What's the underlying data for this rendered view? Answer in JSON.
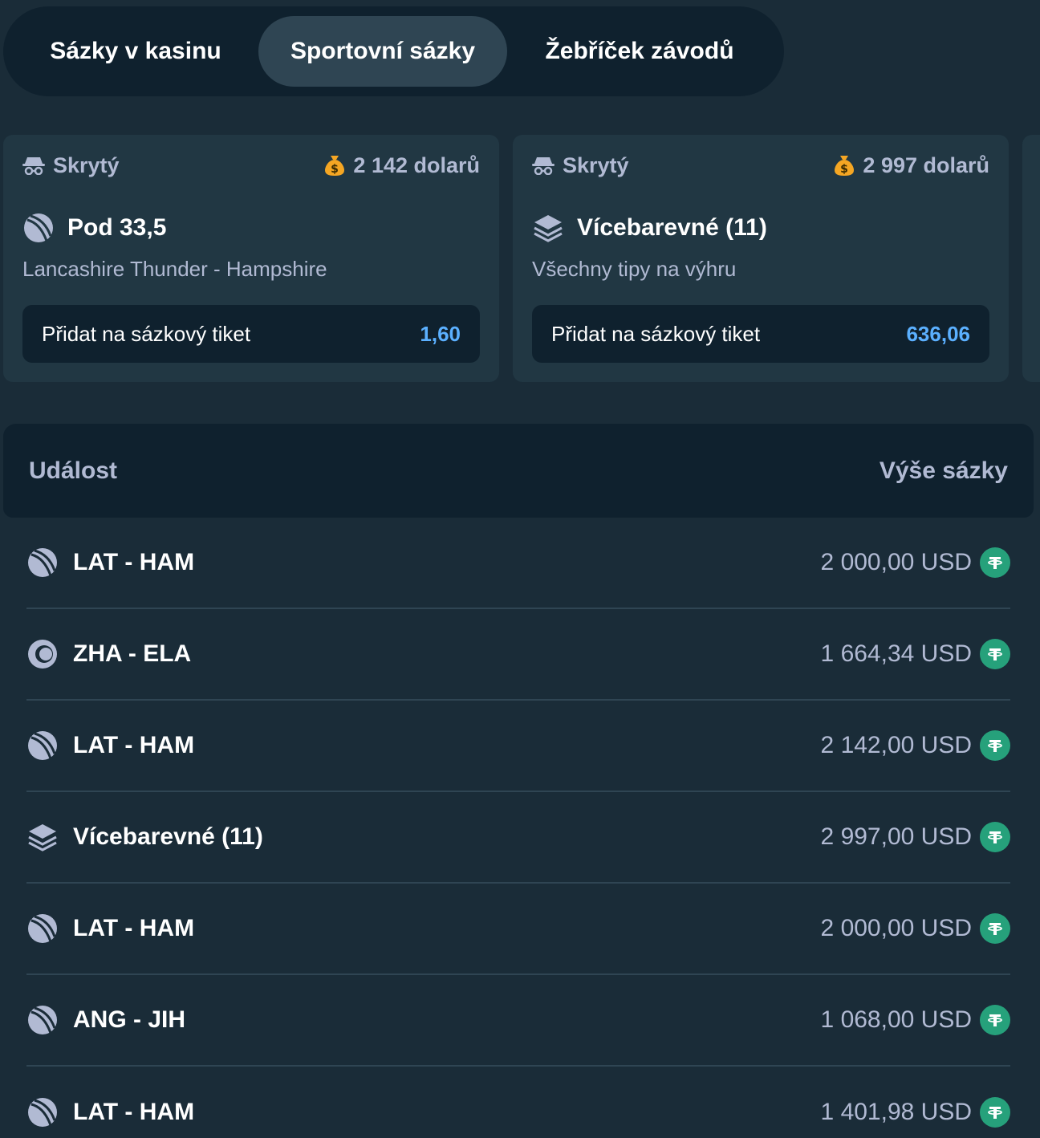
{
  "tabs": [
    {
      "label": "Sázky v kasinu"
    },
    {
      "label": "Sportovní sázky"
    },
    {
      "label": "Žebříček závodů"
    }
  ],
  "cards": [
    {
      "user": "Skrytý",
      "amount": "2 142 dolarů",
      "title": "Pod 33,5",
      "sport_icon": "cricket-ball-icon",
      "subtitle": "Lancashire Thunder - Hampshire",
      "button_label": "Přidat na sázkový tiket",
      "odds": "1,60"
    },
    {
      "user": "Skrytý",
      "amount": "2 997 dolarů",
      "title": "Vícebarevné (11)",
      "sport_icon": "layers-icon",
      "subtitle": "Všechny tipy na výhru",
      "button_label": "Přidat na sázkový tiket",
      "odds": "636,06"
    }
  ],
  "table": {
    "col_event": "Událost",
    "col_amount": "Výše sázky",
    "rows": [
      {
        "event": "LAT - HAM",
        "amount": "2 000,00 USD",
        "icon": "cricket-ball-icon"
      },
      {
        "event": "ZHA - ELA",
        "amount": "1 664,34 USD",
        "icon": "tennis-ball-icon"
      },
      {
        "event": "LAT - HAM",
        "amount": "2 142,00 USD",
        "icon": "cricket-ball-icon"
      },
      {
        "event": "Vícebarevné (11)",
        "amount": "2 997,00 USD",
        "icon": "layers-icon"
      },
      {
        "event": "LAT - HAM",
        "amount": "2 000,00 USD",
        "icon": "cricket-ball-icon"
      },
      {
        "event": "ANG - JIH",
        "amount": "1 068,00 USD",
        "icon": "cricket-ball-icon"
      },
      {
        "event": "LAT - HAM",
        "amount": "1 401,98 USD",
        "icon": "cricket-ball-icon"
      }
    ]
  },
  "colors": {
    "background": "#1a2c38",
    "panel": "#0f212e",
    "card": "#213743",
    "active_tab": "#2f4553",
    "muted_text": "#b1bad3",
    "odds": "#5bb0ff",
    "usdt": "#26a17b",
    "money_bag": "#f5a623"
  }
}
